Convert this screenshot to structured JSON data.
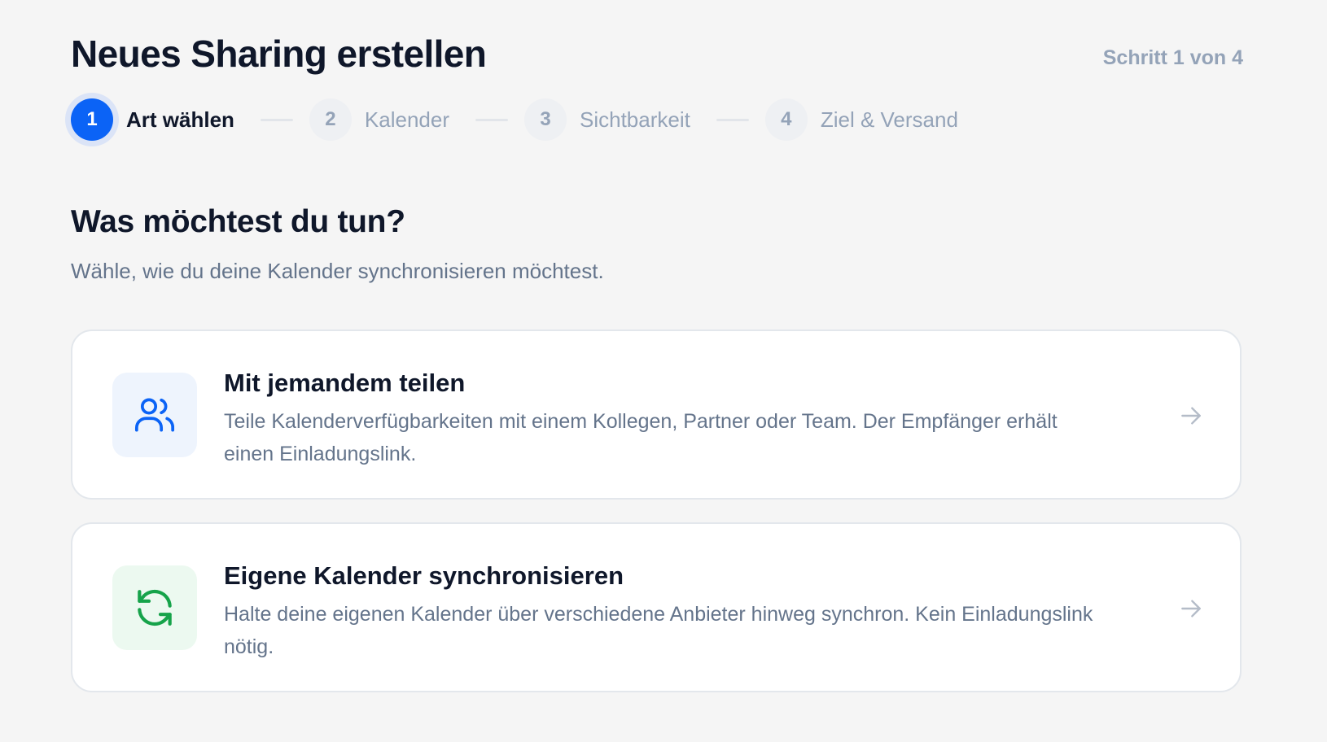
{
  "header": {
    "title": "Neues Sharing erstellen",
    "step_counter": "Schritt 1 von 4"
  },
  "stepper": {
    "steps": [
      {
        "number": "1",
        "label": "Art wählen",
        "active": true
      },
      {
        "number": "2",
        "label": "Kalender",
        "active": false
      },
      {
        "number": "3",
        "label": "Sichtbarkeit",
        "active": false
      },
      {
        "number": "4",
        "label": "Ziel & Versand",
        "active": false
      }
    ]
  },
  "section": {
    "title": "Was möchtest du tun?",
    "subtitle": "Wähle, wie du deine Kalender synchronisieren möchtest."
  },
  "options": [
    {
      "icon": "users-icon",
      "title": "Mit jemandem teilen",
      "description": "Teile Kalenderverfügbarkeiten mit einem Kollegen, Partner oder Team. Der Empfänger erhält einen Einladungslink."
    },
    {
      "icon": "refresh-icon",
      "title": "Eigene Kalender synchronisieren",
      "description": "Halte deine eigenen Kalender über verschiedene Anbieter hinweg synchron. Kein Einladungslink nötig."
    }
  ],
  "colors": {
    "accent": "#0b63f6",
    "sync_green": "#16a34a",
    "background": "#f5f5f5",
    "muted_text": "#64748b"
  }
}
